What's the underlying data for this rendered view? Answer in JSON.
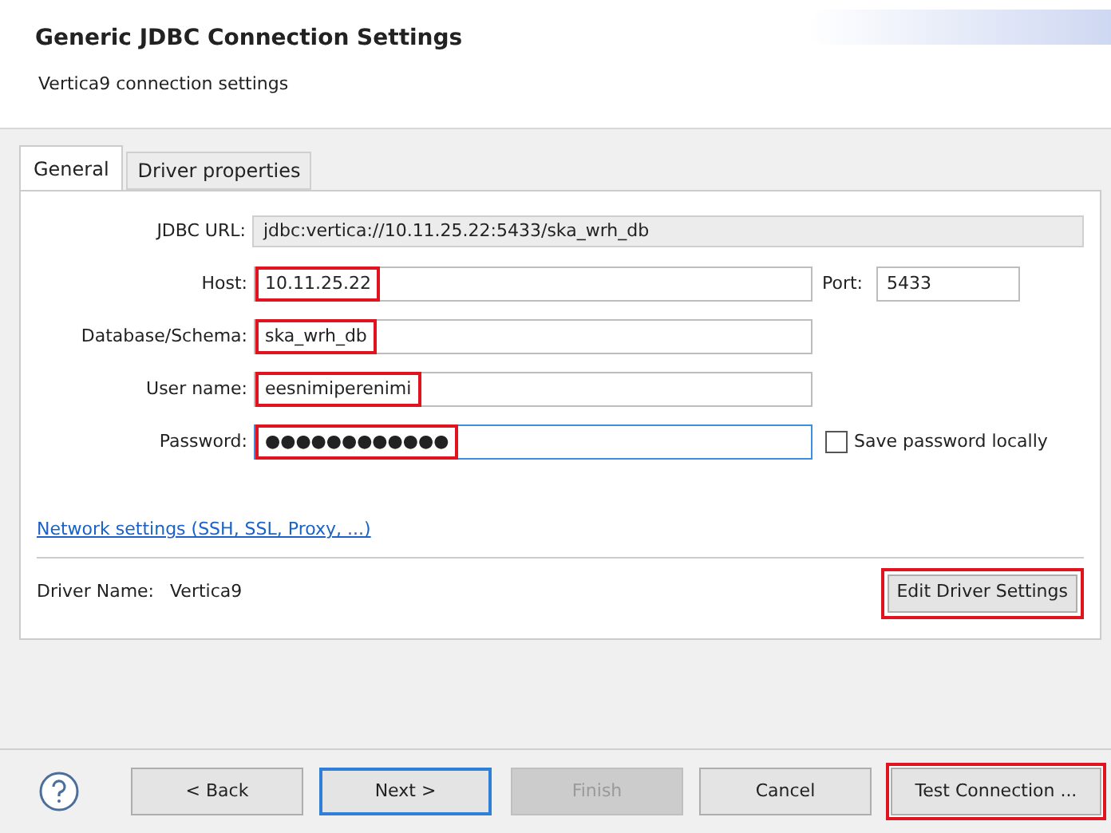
{
  "title": "Generic JDBC Connection Settings",
  "subtitle": "Vertica9 connection settings",
  "tabs": [
    {
      "label": "General",
      "selected": true
    },
    {
      "label": "Driver properties",
      "selected": false
    }
  ],
  "jdbc_url": {
    "label": "JDBC URL:",
    "value": "jdbc:vertica://10.11.25.22:5433/ska_wrh_db"
  },
  "fields": [
    {
      "label": "Host:",
      "value": "10.11.25.22",
      "highlighted": true,
      "focused": false
    },
    {
      "label": "Database/Schema:",
      "value": "ska_wrh_db",
      "highlighted": true,
      "focused": false
    },
    {
      "label": "User name:",
      "value": "eesnimiperenimi",
      "highlighted": true,
      "focused": false
    },
    {
      "label": "Password:",
      "value": "●●●●●●●●●●●●",
      "highlighted": true,
      "focused": true
    }
  ],
  "port": {
    "label": "Port:",
    "value": "5433"
  },
  "save_password": {
    "label": "Save password locally",
    "checked": false
  },
  "network_link": "Network settings (SSH, SSL, Proxy, ...)",
  "driver": {
    "label": "Driver Name:",
    "value": "Vertica9"
  },
  "edit_driver_button": {
    "label": "Edit Driver Settings",
    "highlighted": true
  },
  "buttons": [
    {
      "label": "< Back",
      "disabled": false,
      "default": false,
      "highlighted": false
    },
    {
      "label": "Next >",
      "disabled": false,
      "default": true,
      "highlighted": false
    },
    {
      "label": "Finish",
      "disabled": true,
      "default": false,
      "highlighted": false
    },
    {
      "label": "Cancel",
      "disabled": false,
      "default": false,
      "highlighted": false
    },
    {
      "label": "Test Connection ...",
      "disabled": false,
      "default": false,
      "highlighted": true
    }
  ]
}
